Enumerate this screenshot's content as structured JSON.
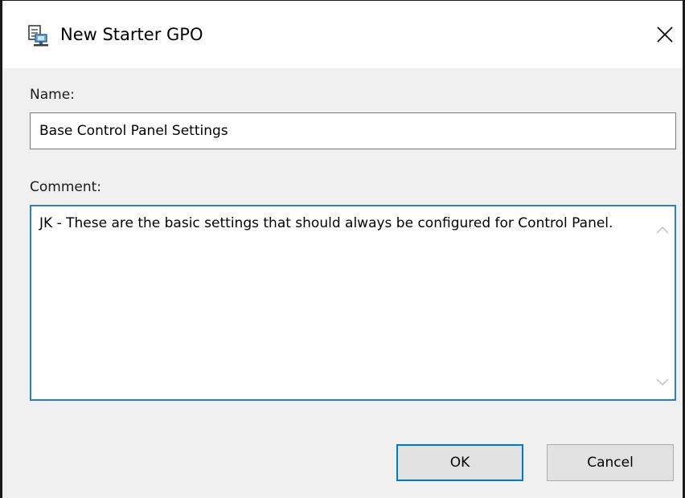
{
  "window": {
    "title": "New Starter GPO",
    "icon": "gpo-icon",
    "close_icon": "close-icon"
  },
  "form": {
    "name_label": "Name:",
    "name_value": "Base Control Panel Settings",
    "comment_label": "Comment:",
    "comment_value": "JK - These are the basic settings that should always be configured for Control Panel."
  },
  "scrollbar": {
    "up_icon": "chevron-up-icon",
    "down_icon": "chevron-down-icon"
  },
  "buttons": {
    "ok_label": "OK",
    "cancel_label": "Cancel"
  },
  "colors": {
    "focus_border": "#2c7cc9",
    "default_button_border": "#0078d7",
    "dialog_background": "#f0f0f0",
    "button_background": "#e1e1e1"
  }
}
